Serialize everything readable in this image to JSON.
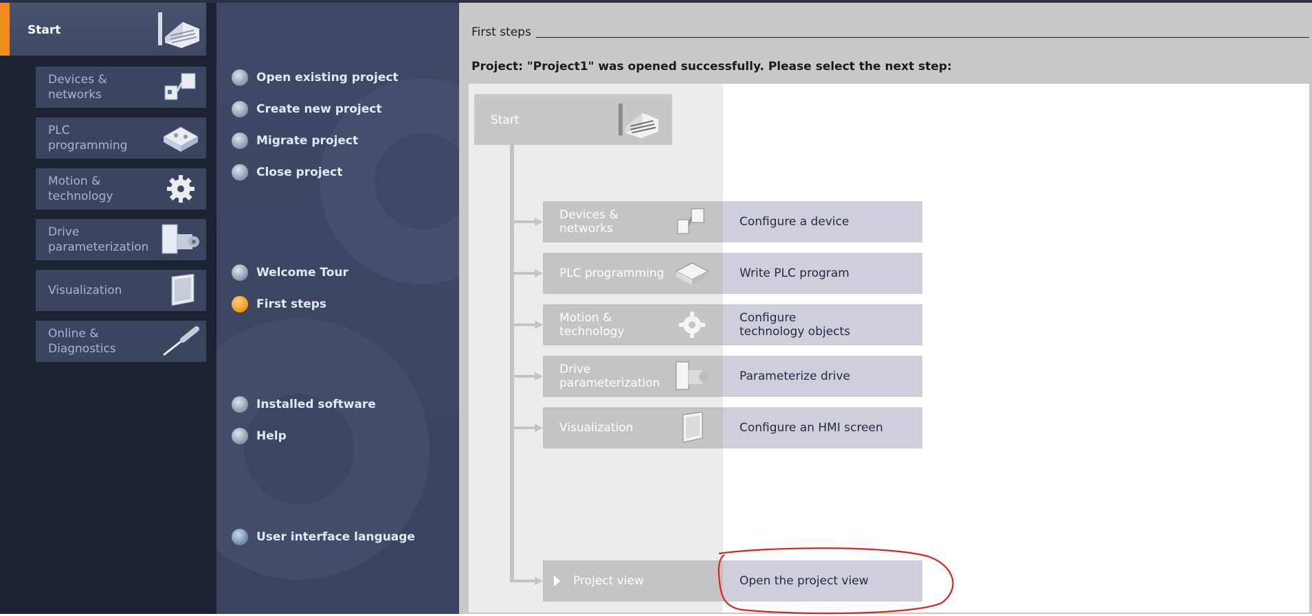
{
  "nav": {
    "start_label": "Start",
    "items": [
      {
        "label": "Devices &\nnetworks",
        "icon": "devices-icon"
      },
      {
        "label": "PLC\nprogramming",
        "icon": "plc-icon"
      },
      {
        "label": "Motion &\ntechnology",
        "icon": "gear-icon"
      },
      {
        "label": "Drive\nparameterization",
        "icon": "drive-icon"
      },
      {
        "label": "Visualization",
        "icon": "hmi-panel-icon"
      },
      {
        "label": "Online &\nDiagnostics",
        "icon": "screwdriver-icon"
      }
    ]
  },
  "actions": {
    "open_existing": "Open existing project",
    "create_new": "Create new project",
    "migrate": "Migrate project",
    "close": "Close project",
    "welcome_tour": "Welcome Tour",
    "first_steps": "First steps",
    "installed_software": "Installed software",
    "help": "Help",
    "ui_language": "User interface language"
  },
  "content": {
    "title": "First steps",
    "message": "Project: \"Project1\" was opened successfully. Please select the next step:",
    "start_label": "Start",
    "steps": [
      {
        "label": "Devices &\nnetworks",
        "action": "Configure a device"
      },
      {
        "label": "PLC programming",
        "action": "Write PLC program"
      },
      {
        "label": "Motion &\ntechnology",
        "action": "Configure\ntechnology objects"
      },
      {
        "label": "Drive\nparameterization",
        "action": "Parameterize drive"
      },
      {
        "label": "Visualization",
        "action": "Configure an HMI screen"
      }
    ],
    "project_view": {
      "label": "Project view",
      "action": "Open the project view"
    }
  },
  "colors": {
    "accent": "#f28a1d",
    "annotation": "#e0201c"
  }
}
